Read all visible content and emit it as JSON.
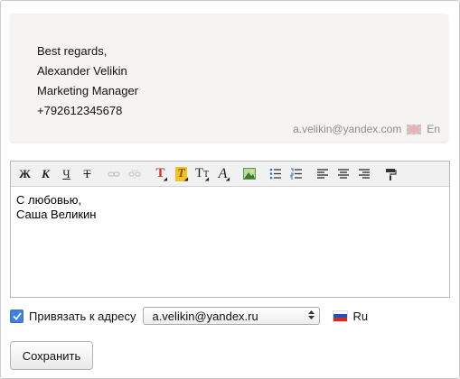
{
  "signature_preview": {
    "lines": [
      "Best regards,",
      "Alexander Velikin",
      "Marketing Manager",
      "+792612345678"
    ],
    "email": "a.velikin@yandex.com",
    "language": "En"
  },
  "toolbar": {
    "buttons": [
      "Ж",
      "К",
      "Ч",
      "Т"
    ]
  },
  "editor": {
    "lines": [
      "С любовью,",
      "Саша Великин"
    ]
  },
  "bind_address": {
    "label": "Привязать к адресу",
    "checked": true,
    "selected_value": "a.velikin@yandex.ru",
    "language": "Ru"
  },
  "save_label": "Сохранить",
  "colors": {
    "card_bg": "#f5f4f1",
    "meta_text": "#8d8d8d",
    "checkbox_blue": "#3d82e0",
    "text_color_red": "#c0392b",
    "highlight_yellow": "#f2c12e"
  }
}
